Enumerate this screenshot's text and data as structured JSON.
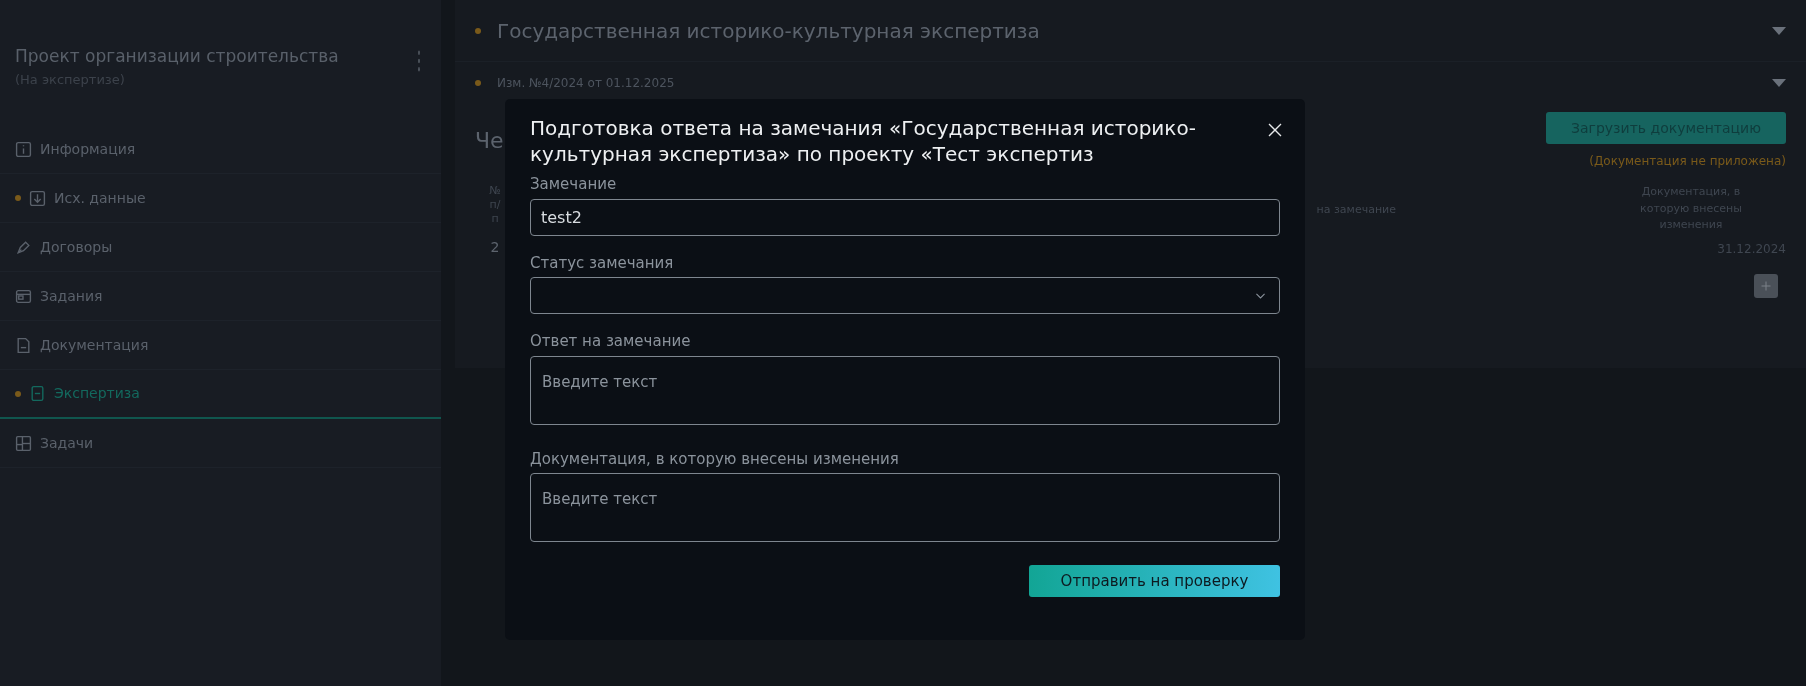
{
  "sidebar": {
    "title": "Проект организации строительства",
    "subtitle": "(На экспертизе)",
    "items": [
      {
        "label": "Информация",
        "dot": false,
        "selected": false
      },
      {
        "label": "Исх. данные",
        "dot": true,
        "selected": false
      },
      {
        "label": "Договоры",
        "dot": false,
        "selected": false
      },
      {
        "label": "Задания",
        "dot": false,
        "selected": false
      },
      {
        "label": "Документация",
        "dot": false,
        "selected": false
      },
      {
        "label": "Экспертиза",
        "dot": true,
        "selected": true
      },
      {
        "label": "Задачи",
        "dot": false,
        "selected": false
      }
    ]
  },
  "main": {
    "section_title": "Государственная историко-культурная экспертиза",
    "revision": "Изм. №4/2024 от 01.12.2025",
    "heading": "Че",
    "upload_button": "Загрузить документацию",
    "notice": "(Документация не приложена)",
    "table": {
      "columns": [
        "№ п/п",
        "на замечание",
        "Документация, в которую внесены изменения"
      ],
      "rows": [
        {
          "number": "2",
          "date": "31.12.2024"
        }
      ]
    }
  },
  "modal": {
    "title": "Подготовка ответа на замечания «Государственная историко-культурная экспертиза» по проекту «Тест экспертиз",
    "fields": [
      {
        "label": "Замечание",
        "kind": "input",
        "value": "test2"
      },
      {
        "label": "Статус замечания",
        "kind": "select"
      },
      {
        "label": "Ответ на замечание",
        "kind": "textarea",
        "placeholder": "Введите текст"
      },
      {
        "label": "Документация, в которую внесены изменения",
        "kind": "textarea",
        "placeholder": "Введите текст"
      }
    ],
    "submit": "Отправить на проверку"
  }
}
